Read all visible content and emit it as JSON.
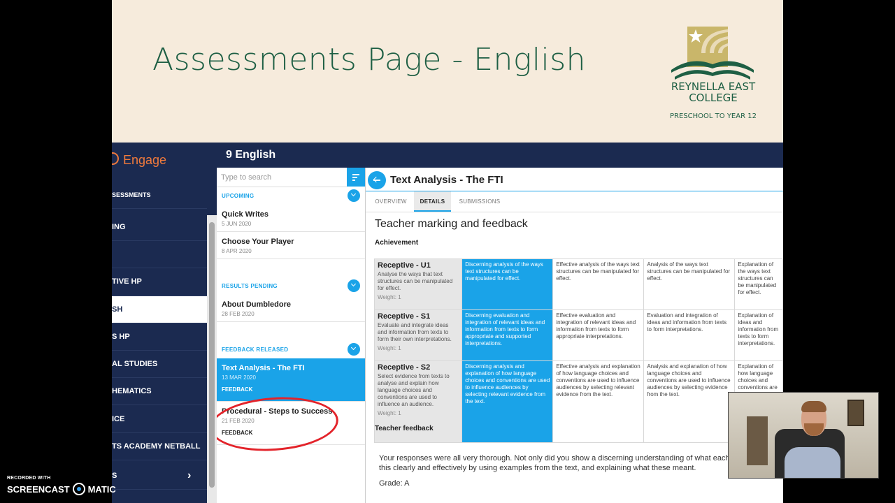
{
  "slide": {
    "title": "Assessments Page - English",
    "logo_name": "REYNELLA EAST COLLEGE",
    "logo_tagline": "PRESCHOOL TO YEAR 12"
  },
  "nav": {
    "brand": "Engage",
    "items": [
      {
        "label": "SESSMENTS"
      },
      {
        "label": "ING"
      },
      {
        "label": ""
      },
      {
        "label": "TIVE HP"
      },
      {
        "label": "SH"
      },
      {
        "label": "S HP"
      },
      {
        "label": "AL STUDIES"
      },
      {
        "label": "HEMATICS"
      },
      {
        "label": "ICE"
      },
      {
        "label": "TS ACADEMY NETBALL"
      },
      {
        "label": "S"
      }
    ]
  },
  "app": {
    "course_title": "9 English"
  },
  "list": {
    "search_placeholder": "Type to search",
    "sections": {
      "upcoming": "UPCOMING",
      "pending": "RESULTS PENDING",
      "released": "FEEDBACK RELEASED"
    },
    "upcoming": [
      {
        "title": "Quick Writes",
        "date": "5 JUN 2020"
      },
      {
        "title": "Choose Your Player",
        "date": "8 APR 2020"
      }
    ],
    "pending": [
      {
        "title": "About Dumbledore",
        "date": "28 FEB 2020"
      }
    ],
    "released": [
      {
        "title": "Text Analysis - The FTI",
        "date": "13 MAR 2020",
        "status": "FEEDBACK"
      },
      {
        "title": "Procedural - Steps to Success",
        "date": "21 FEB 2020",
        "status": "FEEDBACK"
      }
    ]
  },
  "detail": {
    "title": "Text Analysis - The FTI",
    "tabs": [
      "OVERVIEW",
      "DETAILS",
      "SUBMISSIONS"
    ],
    "heading": "Teacher marking and feedback",
    "achievement_label": "Achievement",
    "rubric": [
      {
        "name": "Receptive - U1",
        "desc": "Analyse the ways that text structures can be manipulated for effect.",
        "weight": "Weight: 1",
        "levels": [
          "Discerning analysis of the ways text structures can be manipulated for effect.",
          "Effective analysis of the ways text structures can be manipulated for effect.",
          "Analysis of the ways text structures can be manipulated for effect.",
          "Explanation of the ways text structures can be manipulated for effect."
        ]
      },
      {
        "name": "Receptive - S1",
        "desc": "Evaluate and integrate ideas and information from texts to form their own interpretations.",
        "weight": "Weight: 1",
        "levels": [
          "Discerning evaluation and integration of relevant ideas and information from texts to form appropriate and supported interpretations.",
          "Effective evaluation and integration of relevant ideas and information from texts to form appropriate interpretations.",
          "Evaluation and integration of ideas and information from texts to form interpretations.",
          "Explanation of ideas and information from texts to form interpretations."
        ]
      },
      {
        "name": "Receptive - S2",
        "desc": "Select evidence from texts to analyse and explain how language choices and conventions are used to influence an audience.",
        "weight": "Weight: 1",
        "levels": [
          "Discerning analysis and explanation of how language choices and conventions are used to influence audiences by selecting relevant evidence from the text.",
          "Effective analysis and explanation of how language choices and conventions are used to influence audiences by selecting relevant evidence from the text.",
          "Analysis and explanation of how language choices and conventions are used to influence audiences by selecting evidence from the text.",
          "Explanation of how language choices and conventions are used to influence audiences by selecting general evidence from the text."
        ]
      }
    ],
    "feedback_label": "Teacher feedback",
    "feedback_line1": "Your responses were all very thorough. Not only did you show a discerning understanding of what each au",
    "feedback_line2": "this clearly and effectively by using examples from the text, and explaining what these meant.",
    "grade": "Grade: A"
  },
  "watermark": {
    "small": "RECORDED WITH",
    "left": "SCREENCAST",
    "right": "MATIC"
  },
  "colors": {
    "navy": "#1b2a50",
    "accent": "#1aa3e8",
    "brand_orange": "#f07a3c",
    "slide_green": "#1e5f44",
    "annotation_red": "#e3232a"
  }
}
